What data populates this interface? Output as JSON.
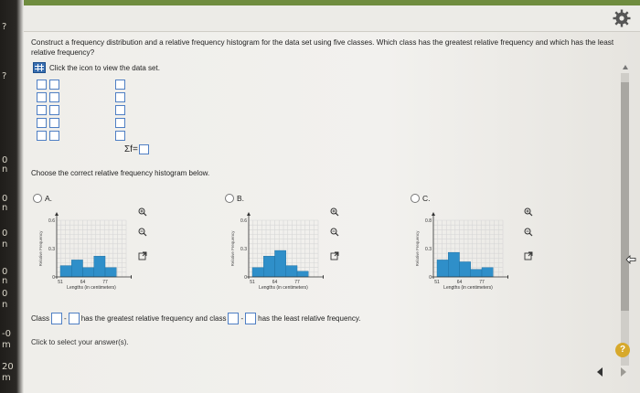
{
  "left_edge_chars": [
    "?",
    "?",
    "0",
    "n",
    "0",
    "n",
    "0",
    "n",
    "0",
    "n",
    "0",
    "n",
    "-0",
    "m",
    "20",
    "m"
  ],
  "question": {
    "text": "Construct a frequency distribution and a relative frequency histogram for the data set using five classes. Which class has the greatest relative frequency and which has the least relative frequency?",
    "dataset_link": "Click the icon to view the data set."
  },
  "sigma_label": "Σf=",
  "choose_label": "Choose the correct relative frequency histogram below.",
  "options": [
    {
      "label": "A.",
      "chart_data": {
        "type": "bar",
        "title": "",
        "xlabel": "Lengths (in centimeters)",
        "ylabel": "Relative Frequency",
        "ylim": [
          0,
          0.6
        ],
        "yticks": [
          "0.6",
          "0.3",
          "0"
        ],
        "xticks": [
          "51",
          "64",
          "77"
        ],
        "values": [
          0.12,
          0.18,
          0.1,
          0.22,
          0.1
        ]
      }
    },
    {
      "label": "B.",
      "chart_data": {
        "type": "bar",
        "title": "",
        "xlabel": "Lengths (in centimeters)",
        "ylabel": "Relative Frequency",
        "ylim": [
          0,
          0.6
        ],
        "yticks": [
          "0.6",
          "0.3",
          "0"
        ],
        "xticks": [
          "51",
          "64",
          "77"
        ],
        "values": [
          0.1,
          0.22,
          0.28,
          0.12,
          0.06
        ]
      }
    },
    {
      "label": "C.",
      "chart_data": {
        "type": "bar",
        "title": "",
        "xlabel": "Lengths (in centimeters)",
        "ylabel": "Relative Frequency",
        "ylim": [
          0,
          0.6
        ],
        "yticks": [
          "0.8",
          "0.3",
          "0"
        ],
        "xticks": [
          "51",
          "64",
          "77"
        ],
        "values": [
          0.18,
          0.26,
          0.16,
          0.08,
          0.1
        ]
      }
    }
  ],
  "answer": {
    "prefix": "Class",
    "middle": "has the greatest relative frequency and class",
    "suffix": "has the least relative frequency."
  },
  "click_to_select": "Click to select your answer(s).",
  "help_label": "?",
  "colors": {
    "bar": "#2f8fc9",
    "accent": "#4f7fc4",
    "topbar": "#6f8c3f",
    "help": "#d7a92c"
  }
}
